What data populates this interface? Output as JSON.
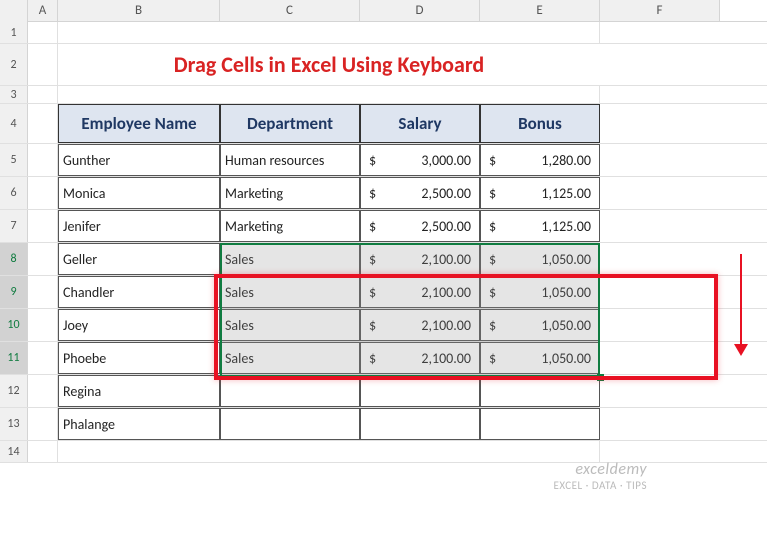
{
  "columns": [
    "A",
    "B",
    "C",
    "D",
    "E",
    "F"
  ],
  "rows": [
    "1",
    "2",
    "3",
    "4",
    "5",
    "6",
    "7",
    "8",
    "9",
    "10",
    "11",
    "12",
    "13",
    "14"
  ],
  "title": "Drag Cells in Excel Using Keyboard",
  "headers": {
    "b": "Employee Name",
    "c": "Department",
    "d": "Salary",
    "e": "Bonus"
  },
  "data": [
    {
      "name": "Gunther",
      "dept": "Human resources",
      "sal": "3,000.00",
      "bon": "1,280.00"
    },
    {
      "name": "Monica",
      "dept": "Marketing",
      "sal": "2,500.00",
      "bon": "1,125.00"
    },
    {
      "name": "Jenifer",
      "dept": "Marketing",
      "sal": "2,500.00",
      "bon": "1,125.00"
    },
    {
      "name": "Geller",
      "dept": "Sales",
      "sal": "2,100.00",
      "bon": "1,050.00"
    },
    {
      "name": "Chandler",
      "dept": "Sales",
      "sal": "2,100.00",
      "bon": "1,050.00"
    },
    {
      "name": "Joey",
      "dept": "Sales",
      "sal": "2,100.00",
      "bon": "1,050.00"
    },
    {
      "name": "Phoebe",
      "dept": "Sales",
      "sal": "2,100.00",
      "bon": "1,050.00"
    },
    {
      "name": "Regina",
      "dept": "",
      "sal": "",
      "bon": ""
    },
    {
      "name": "Phalange",
      "dept": "",
      "sal": "",
      "bon": ""
    }
  ],
  "currency": "$",
  "watermark": {
    "brand": "exceldemy",
    "tag": "EXCEL · DATA · TIPS"
  },
  "chart_data": {
    "type": "table",
    "title": "Drag Cells in Excel Using Keyboard",
    "columns": [
      "Employee Name",
      "Department",
      "Salary",
      "Bonus"
    ],
    "rows": [
      [
        "Gunther",
        "Human resources",
        3000.0,
        1280.0
      ],
      [
        "Monica",
        "Marketing",
        2500.0,
        1125.0
      ],
      [
        "Jenifer",
        "Marketing",
        2500.0,
        1125.0
      ],
      [
        "Geller",
        "Sales",
        2100.0,
        1050.0
      ],
      [
        "Chandler",
        "Sales",
        2100.0,
        1050.0
      ],
      [
        "Joey",
        "Sales",
        2100.0,
        1050.0
      ],
      [
        "Phoebe",
        "Sales",
        2100.0,
        1050.0
      ],
      [
        "Regina",
        null,
        null,
        null
      ],
      [
        "Phalange",
        null,
        null,
        null
      ]
    ],
    "selection": "C8:E11",
    "highlighted_rows": "9:11"
  }
}
